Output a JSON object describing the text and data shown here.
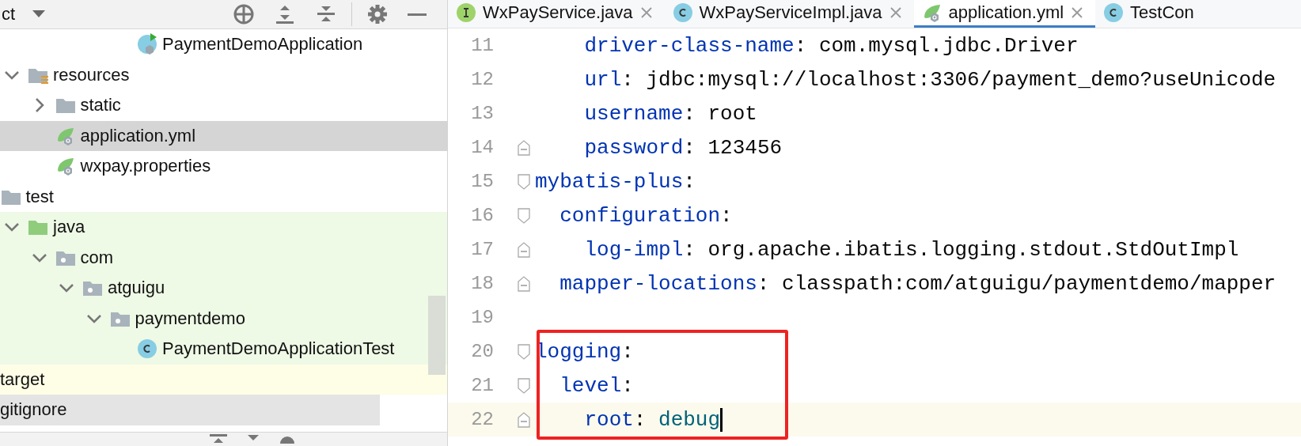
{
  "project_panel": {
    "title": "ct",
    "tree": [
      {
        "children": [
          {
            "children": [
              {
                "children": [
                  {
                    "children": [
                      {
                        "children": [
                          {
                            "children": [
                              {
                                "label": "PaymentDemoApplication",
                                "kind": "spring-class"
                              }
                            ]
                          }
                        ]
                      }
                    ]
                  }
                ]
              },
              {
                "label": "resources",
                "kind": "resources-folder",
                "expanded": true,
                "children": [
                  {
                    "label": "static",
                    "kind": "folder",
                    "expanded": false
                  },
                  {
                    "label": "application.yml",
                    "kind": "spring-config",
                    "selected": true
                  },
                  {
                    "label": "wxpay.properties",
                    "kind": "spring-config",
                    "selected": false
                  }
                ]
              }
            ]
          },
          {
            "label": "test",
            "kind": "folder",
            "children": [
              {
                "label": "java",
                "kind": "test-folder",
                "expanded": true,
                "test_source": true,
                "children": [
                  {
                    "label": "com",
                    "kind": "package",
                    "expanded": true,
                    "test_source": true,
                    "children": [
                      {
                        "label": "atguigu",
                        "kind": "package",
                        "expanded": true,
                        "test_source": true,
                        "children": [
                          {
                            "label": "paymentdemo",
                            "kind": "package",
                            "expanded": true,
                            "test_source": true,
                            "children": [
                              {
                                "label": "PaymentDemoApplicationTest",
                                "kind": "class",
                                "test_source": true
                              }
                            ]
                          }
                        ]
                      }
                    ]
                  }
                ]
              }
            ]
          }
        ]
      },
      {
        "label": "target",
        "excluded": true
      },
      {
        "label": "gitignore",
        "ignored": true
      }
    ]
  },
  "editor": {
    "tabs": [
      {
        "label": "WxPayService.java",
        "kind": "interface",
        "selected": false,
        "closable": true
      },
      {
        "label": "WxPayServiceImpl.java",
        "kind": "class",
        "selected": false,
        "closable": true
      },
      {
        "label": "application.yml",
        "kind": "spring-config",
        "selected": true,
        "closable": true
      },
      {
        "label": "TestCon",
        "kind": "class",
        "selected": false,
        "closable": false
      }
    ],
    "lines": [
      {
        "number": "11",
        "key": "    driver-class-name:",
        "value": "com.mysql.jdbc.Driver"
      },
      {
        "number": "12",
        "key": "    url:",
        "value": "jdbc:mysql://localhost:3306/payment_demo?useUnicode"
      },
      {
        "number": "13",
        "key": "    username:",
        "value": "root"
      },
      {
        "number": "14",
        "key": "    password:",
        "value": "123456",
        "fold_end": true
      },
      {
        "number": "15",
        "key": "mybatis-plus:",
        "fold_start": true
      },
      {
        "number": "16",
        "key": "  configuration:",
        "fold_start": true
      },
      {
        "number": "17",
        "key": "    log-impl:",
        "value": "org.apache.ibatis.logging.stdout.StdOutImpl",
        "fold_end": true
      },
      {
        "number": "18",
        "key": "  mapper-locations:",
        "value": "classpath:com/atguigu/paymentdemo/mapper",
        "fold_end": true
      },
      {
        "number": "19"
      },
      {
        "number": "20",
        "key": "logging:",
        "fold_start": true,
        "boxed": true
      },
      {
        "number": "21",
        "key": "  level:",
        "fold_start": true,
        "boxed": true
      },
      {
        "number": "22",
        "key": "    root:",
        "value": "debug",
        "keyword": true,
        "fold_end": true,
        "boxed": true,
        "current": true
      }
    ]
  }
}
